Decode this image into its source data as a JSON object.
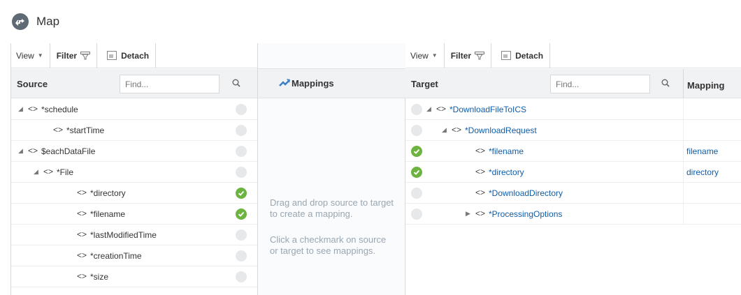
{
  "header": {
    "title": "Map",
    "icon": "map-icon"
  },
  "source": {
    "toolbar": {
      "view_label": "View",
      "filter_label": "Filter",
      "detach_label": "Detach"
    },
    "column_title": "Source",
    "find_placeholder": "Find...",
    "rows": [
      {
        "label": "*schedule",
        "expander": "◢",
        "indent": 0,
        "mapped": false
      },
      {
        "label": "*startTime",
        "expander": "",
        "indent": 1,
        "mapped": false
      },
      {
        "label": "$eachDataFile",
        "expander": "◢",
        "indent": 0,
        "mapped": false
      },
      {
        "label": "*File",
        "expander": "◢",
        "indent": 1,
        "mapped": false
      },
      {
        "label": "*directory",
        "expander": "",
        "indent": 2,
        "mapped": true
      },
      {
        "label": "*filename",
        "expander": "",
        "indent": 2,
        "mapped": true
      },
      {
        "label": "*lastModifiedTime",
        "expander": "",
        "indent": 2,
        "mapped": false
      },
      {
        "label": "*creationTime",
        "expander": "",
        "indent": 2,
        "mapped": false
      },
      {
        "label": "*size",
        "expander": "",
        "indent": 2,
        "mapped": false
      }
    ]
  },
  "mappings": {
    "title": "Mappings",
    "help_1": "Drag and drop source to target to create a mapping.",
    "help_2": "Click a checkmark on source or target to see mappings."
  },
  "target": {
    "toolbar": {
      "view_label": "View",
      "filter_label": "Filter",
      "detach_label": "Detach"
    },
    "column_title": "Target",
    "find_placeholder": "Find...",
    "mapping_column_title": "Mapping",
    "rows": [
      {
        "label": "*DownloadFileToICS",
        "expander": "◢",
        "indent": 0,
        "mapped": false,
        "mapping": ""
      },
      {
        "label": "*DownloadRequest",
        "expander": "◢",
        "indent": 1,
        "mapped": false,
        "mapping": ""
      },
      {
        "label": "*filename",
        "expander": "",
        "indent": 2,
        "mapped": true,
        "mapping": "filename"
      },
      {
        "label": "*directory",
        "expander": "",
        "indent": 2,
        "mapped": true,
        "mapping": "directory"
      },
      {
        "label": "*DownloadDirectory",
        "expander": "",
        "indent": 2,
        "mapped": false,
        "mapping": ""
      },
      {
        "label": "*ProcessingOptions",
        "expander": "▶",
        "indent": 2,
        "mapped": false,
        "mapping": ""
      }
    ]
  },
  "colors": {
    "mapped_check": "#6db33f",
    "link_blue": "#0f5da8",
    "help_text": "#9aa6b2"
  }
}
